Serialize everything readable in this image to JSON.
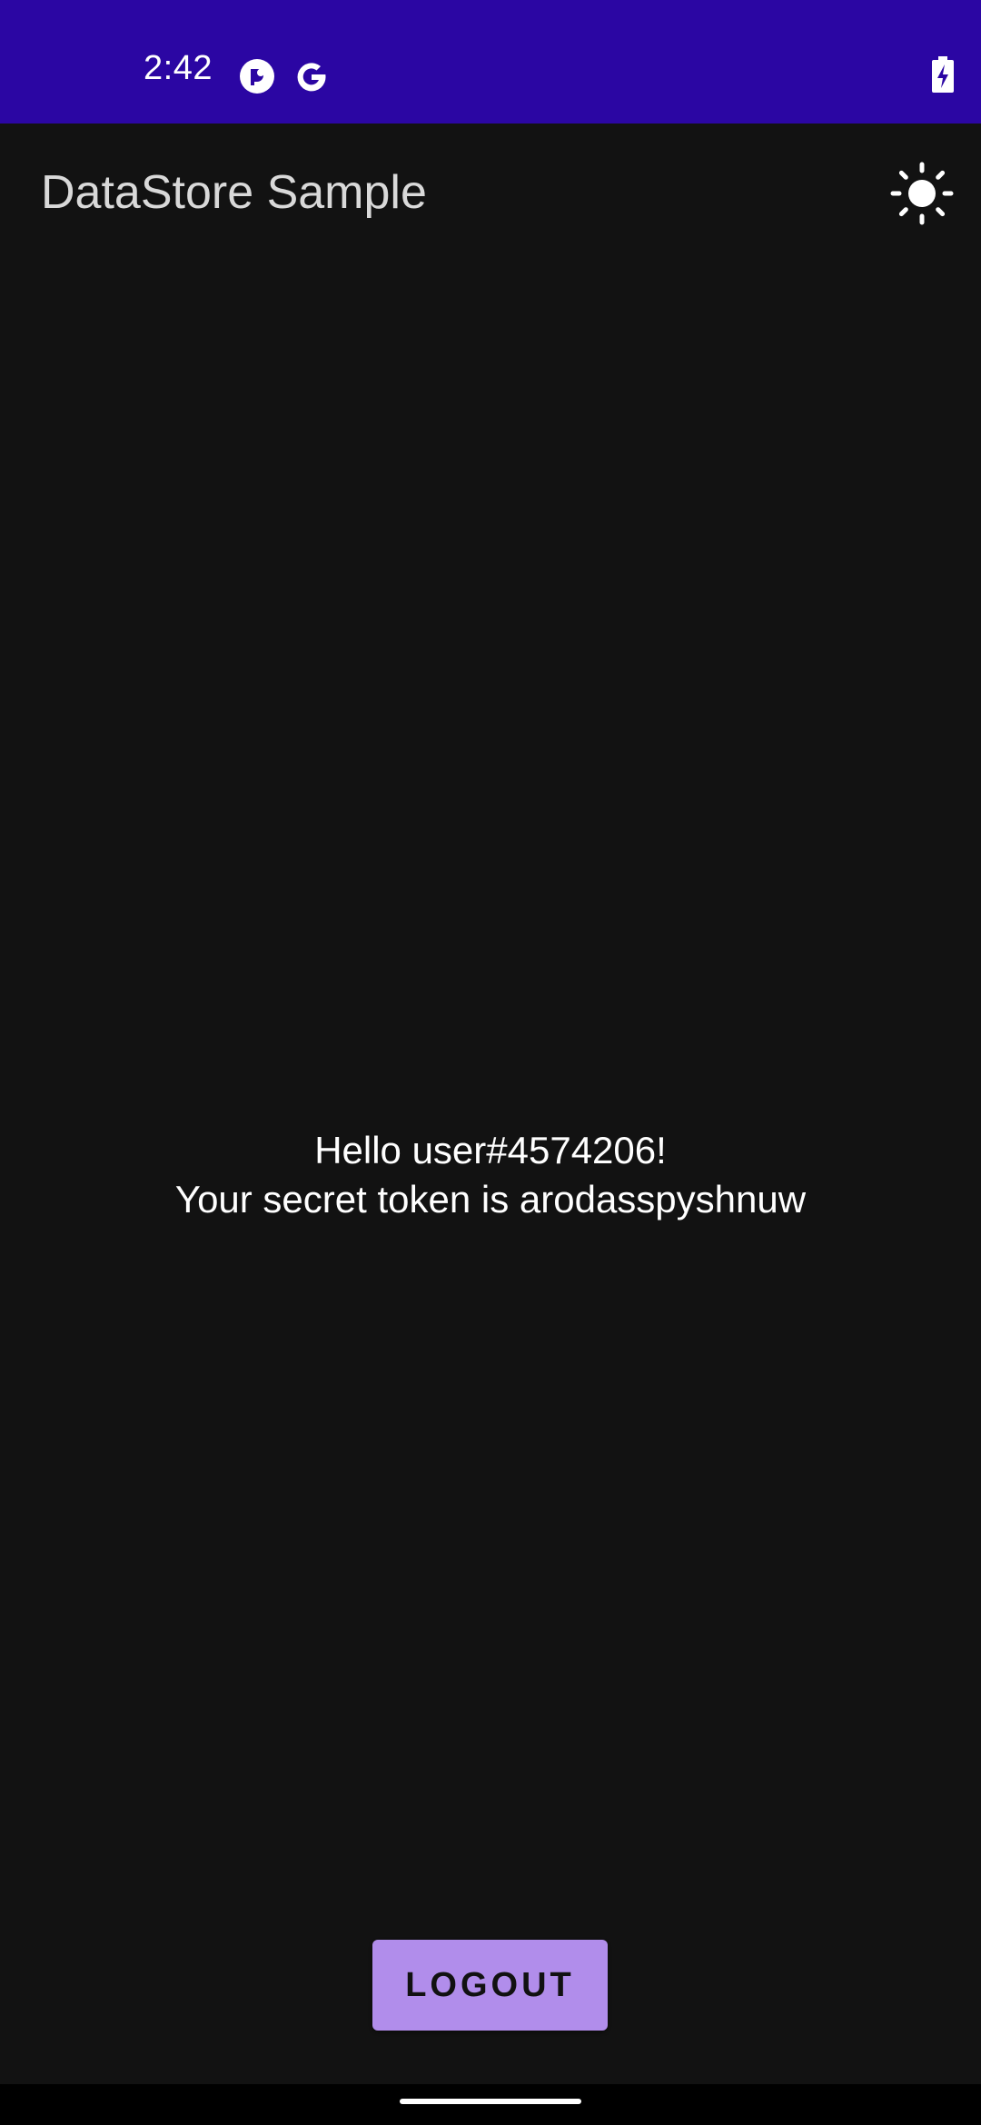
{
  "status_bar": {
    "time": "2:42",
    "icons": [
      "pocket-casts-icon",
      "google-icon",
      "battery-charging-icon"
    ],
    "background": "#2b06a3"
  },
  "app_bar": {
    "title": "DataStore Sample",
    "action_icon": "sun-icon"
  },
  "main": {
    "greeting_line1": "Hello user#4574206!",
    "greeting_line2": "Your secret token is arodasspyshnuw"
  },
  "actions": {
    "logout_label": "LOGOUT",
    "logout_color": "#b18deb"
  },
  "colors": {
    "background": "#121212",
    "title_text": "#d9d9d9",
    "body_text": "#ffffff"
  }
}
